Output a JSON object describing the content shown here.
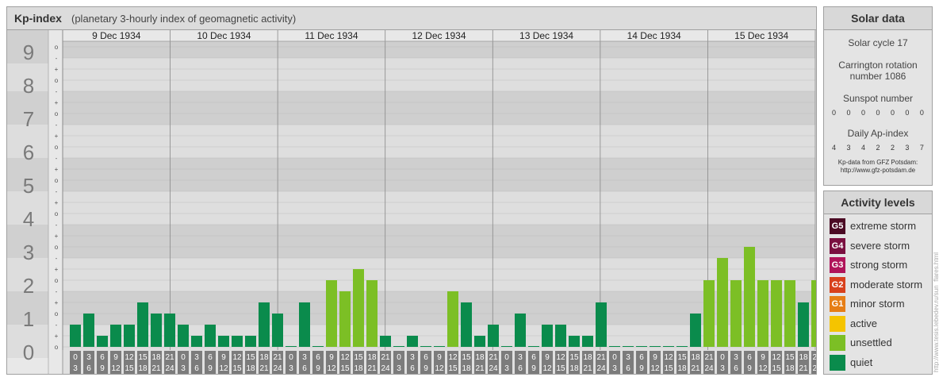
{
  "header": {
    "title": "Kp-index",
    "subtitle": "(planetary 3-hourly index of geomagnetic activity)"
  },
  "chart_data": {
    "type": "bar",
    "title": "Kp-index",
    "subtitle": "(planetary 3-hourly index of geomagnetic activity)",
    "days": [
      "9 Dec 1934",
      "10 Dec 1934",
      "11 Dec 1934",
      "12 Dec 1934",
      "13 Dec 1934",
      "14 Dec 1934",
      "15 Dec 1934"
    ],
    "y_ticks": [
      "0",
      "1",
      "2",
      "3",
      "4",
      "5",
      "6",
      "7",
      "8",
      "9"
    ],
    "y_minor_labels": [
      "o",
      "+",
      "-"
    ],
    "ylim": [
      0,
      9.333
    ],
    "interval_labels": [
      [
        "0",
        "3"
      ],
      [
        "3",
        "6"
      ],
      [
        "6",
        "9"
      ],
      [
        "9",
        "12"
      ],
      [
        "12",
        "15"
      ],
      [
        "15",
        "18"
      ],
      [
        "18",
        "21"
      ],
      [
        "21",
        "24"
      ]
    ],
    "values": [
      0.667,
      1,
      0.333,
      0.667,
      0.667,
      1.333,
      1,
      1,
      0.667,
      0.333,
      0.667,
      0.333,
      0.333,
      0.333,
      1.333,
      1,
      0,
      1.333,
      0,
      2,
      1.667,
      2.333,
      2,
      0.333,
      0,
      0.333,
      0,
      0,
      1.667,
      1.333,
      0.333,
      0.667,
      0,
      1,
      0,
      0.667,
      0.667,
      0.333,
      0.333,
      1.333,
      0,
      0,
      0,
      0,
      0,
      0,
      1,
      2,
      2.667,
      2,
      3,
      2,
      2,
      2,
      1.333,
      2,
      0
    ],
    "colors": {
      "quiet": "#0a8b4c",
      "unsettled": "#7cbf25",
      "active": "#f5c400"
    }
  },
  "solar": {
    "title": "Solar data",
    "cycle": "Solar cycle 17",
    "carrington": "Carrington rotation number 1086",
    "sunspot_title": "Sunspot number",
    "sunspot_values": [
      "0",
      "0",
      "0",
      "0",
      "0",
      "0",
      "0"
    ],
    "ap_title": "Daily Ap-index",
    "ap_values": [
      "4",
      "3",
      "4",
      "2",
      "2",
      "3",
      "7"
    ],
    "source_line1": "Kp-data from GFZ Potsdam:",
    "source_line2": "http://www.gfz-potsdam.de"
  },
  "activity": {
    "title": "Activity levels",
    "items": [
      {
        "badge": "G5",
        "label": "extreme storm",
        "color": "#4b0a24"
      },
      {
        "badge": "G4",
        "label": "severe storm",
        "color": "#7a1040"
      },
      {
        "badge": "G3",
        "label": "strong storm",
        "color": "#b0145a"
      },
      {
        "badge": "G2",
        "label": "moderate storm",
        "color": "#d8401c"
      },
      {
        "badge": "G1",
        "label": "minor storm",
        "color": "#e67e16"
      },
      {
        "badge": "",
        "label": "active",
        "color": "#f5c400"
      },
      {
        "badge": "",
        "label": "unsettled",
        "color": "#7cbf25"
      },
      {
        "badge": "",
        "label": "quiet",
        "color": "#0a8b4c"
      }
    ]
  },
  "credit": "http://www.tesis.lebedev.ru/sun_flares.html"
}
